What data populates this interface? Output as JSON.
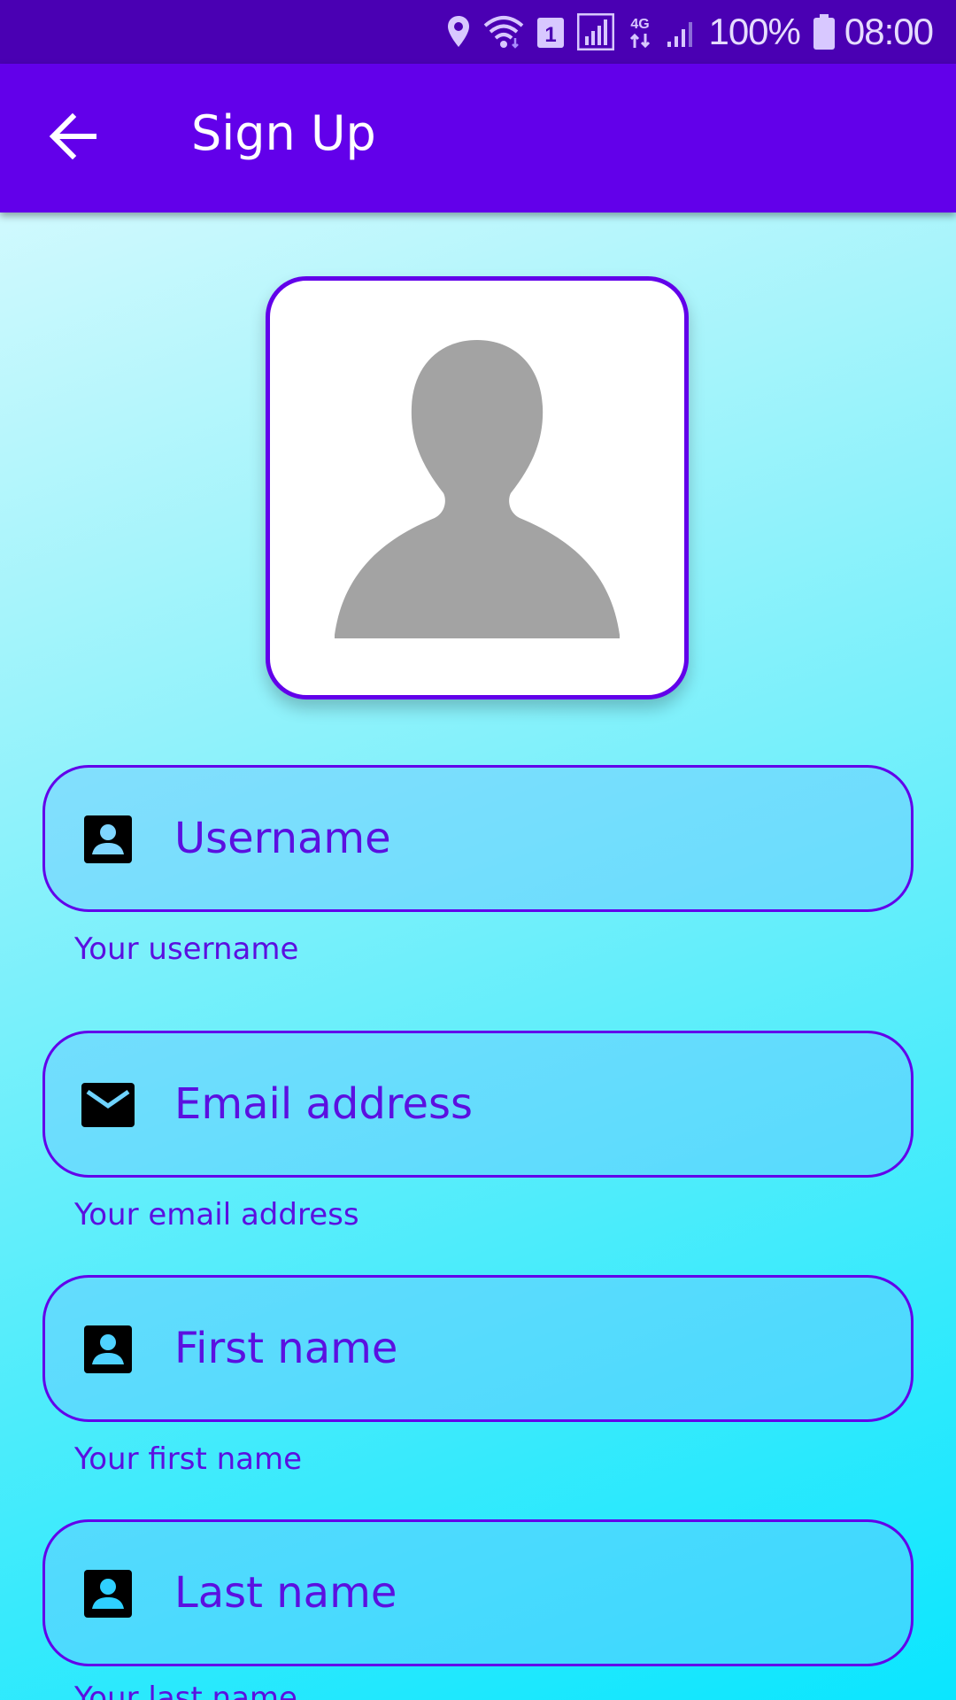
{
  "status_bar": {
    "battery": "100%",
    "time": "08:00",
    "sim_badge": "1",
    "network_label": "4G",
    "icons": [
      "location-icon",
      "wifi-icon",
      "sim-icon",
      "signal-icon",
      "network-4g-icon",
      "signal-icon",
      "battery-icon"
    ]
  },
  "app_bar": {
    "title": "Sign Up",
    "back_icon": "arrow-back-icon",
    "color": "#6200ea"
  },
  "avatar": {
    "icon": "person-placeholder-icon"
  },
  "fields": [
    {
      "placeholder": "Username",
      "helper": "Your username",
      "icon": "account-box-icon"
    },
    {
      "placeholder": "Email address",
      "helper": "Your email address",
      "icon": "mail-icon"
    },
    {
      "placeholder": "First name",
      "helper": "Your first name",
      "icon": "account-box-icon"
    },
    {
      "placeholder": "Last name",
      "helper": "Your last name",
      "icon": "account-box-icon"
    }
  ],
  "colors": {
    "primary": "#6200ea",
    "status_bar": "#4a00b3",
    "text_accent": "#5b10e0"
  }
}
